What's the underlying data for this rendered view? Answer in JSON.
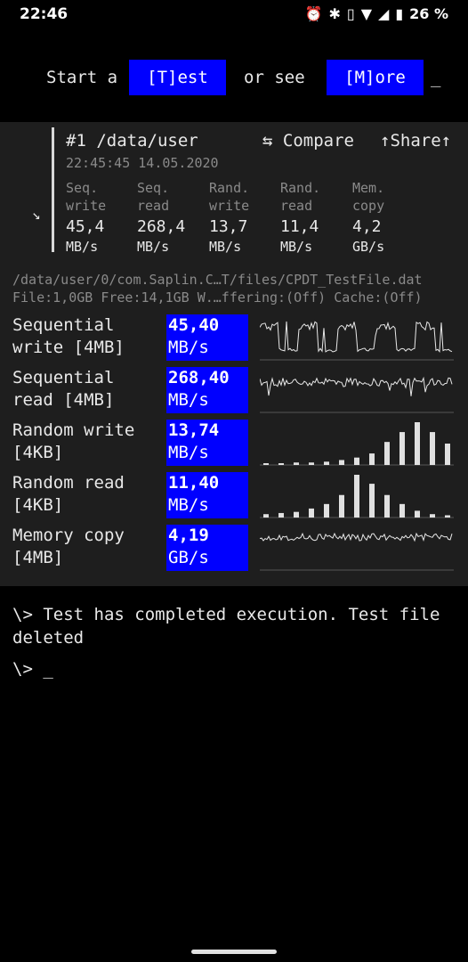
{
  "status_bar": {
    "time": "22:46",
    "battery": "26 %",
    "icons": [
      "alarm-icon",
      "bluetooth-icon",
      "vibrate-icon",
      "wifi-icon",
      "signal-icon",
      "battery-icon"
    ]
  },
  "command_line": {
    "prefix": "Start a",
    "test_button": "[T]est",
    "middle": "or see",
    "more_button": "[M]ore",
    "cursor": "_"
  },
  "result": {
    "title": "#1 /data/user",
    "timestamp": "22:45:45 14.05.2020",
    "compare_label": "⇆ Compare",
    "share_label": "↑Share↑",
    "summary": [
      {
        "line1": "Seq.",
        "line2": "write",
        "value": "45,4",
        "unit": "MB/s"
      },
      {
        "line1": "Seq.",
        "line2": "read",
        "value": "268,4",
        "unit": "MB/s"
      },
      {
        "line1": "Rand.",
        "line2": "write",
        "value": "13,7",
        "unit": "MB/s"
      },
      {
        "line1": "Rand.",
        "line2": "read",
        "value": "11,4",
        "unit": "MB/s"
      },
      {
        "line1": "Mem.",
        "line2": "copy",
        "value": "4,2",
        "unit": "GB/s"
      }
    ],
    "path_line1": "/data/user/0/com.Saplin.C…T/files/CPDT_TestFile.dat",
    "path_line2": "File:1,0GB Free:14,1GB W.…ffering:(Off) Cache:(Off)",
    "tests": [
      {
        "name1": "Sequential",
        "name2": "write [4MB]",
        "value": "45,40",
        "unit": "MB/s"
      },
      {
        "name1": "Sequential",
        "name2": "read [4MB]",
        "value": "268,40",
        "unit": "MB/s"
      },
      {
        "name1": "Random write",
        "name2": "[4KB]",
        "value": "13,74",
        "unit": "MB/s"
      },
      {
        "name1": "Random read",
        "name2": "[4KB]",
        "value": "11,40",
        "unit": "MB/s"
      },
      {
        "name1": "Memory copy",
        "name2": "[4MB]",
        "value": "4,19",
        "unit": "GB/s"
      }
    ],
    "histograms": {
      "random_write": [
        1,
        2,
        3,
        3,
        4,
        6,
        9,
        14,
        28,
        40,
        52,
        40,
        26
      ],
      "random_read": [
        3,
        4,
        5,
        8,
        12,
        20,
        38,
        30,
        20,
        12,
        6,
        3,
        2
      ]
    }
  },
  "console": {
    "message": "\\> Test has completed execution. Test file deleted",
    "prompt": "\\> _"
  }
}
